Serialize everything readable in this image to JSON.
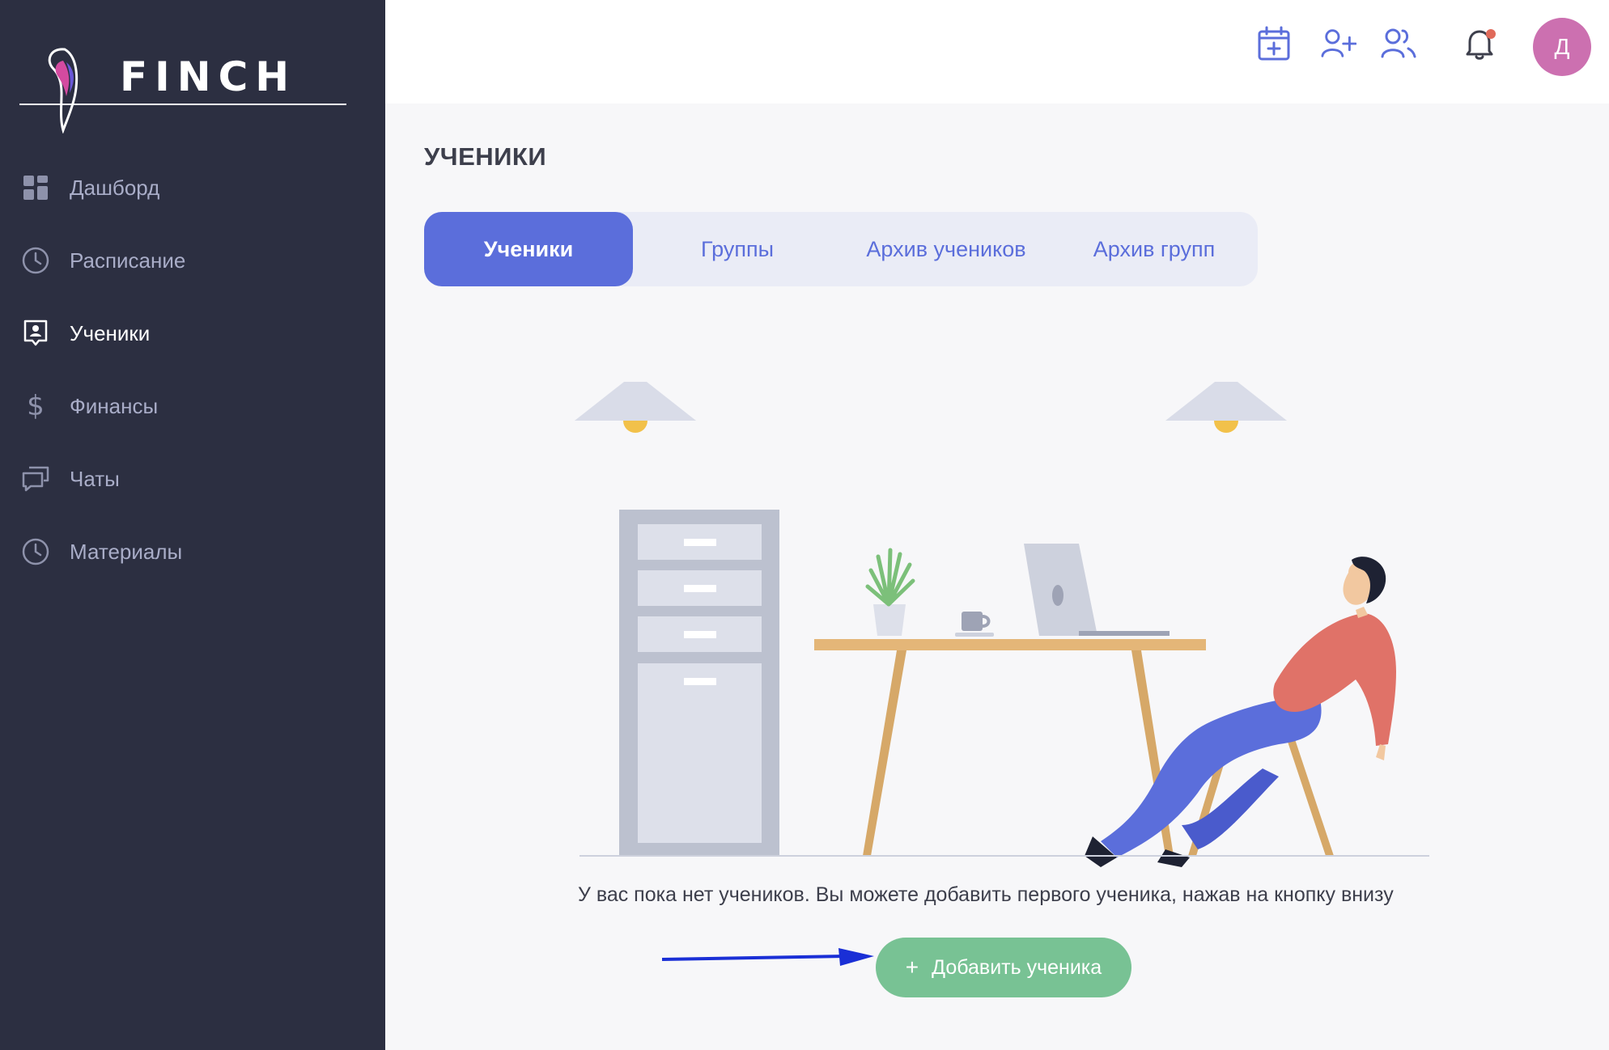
{
  "brand": {
    "name": "FINCH"
  },
  "sidebar": {
    "items": [
      {
        "label": "Дашборд",
        "icon": "dashboard-icon"
      },
      {
        "label": "Расписание",
        "icon": "clock-icon"
      },
      {
        "label": "Ученики",
        "icon": "student-card-icon",
        "active": true
      },
      {
        "label": "Финансы",
        "icon": "dollar-icon"
      },
      {
        "label": "Чаты",
        "icon": "chat-icon"
      },
      {
        "label": "Материалы",
        "icon": "clock-icon"
      }
    ]
  },
  "header": {
    "icons": [
      "calendar-add-icon",
      "add-user-icon",
      "users-icon",
      "bell-icon"
    ],
    "avatar_initial": "Д"
  },
  "main": {
    "title": "УЧЕНИКИ",
    "tabs": [
      {
        "label": "Ученики",
        "active": true
      },
      {
        "label": "Группы"
      },
      {
        "label": "Архив учеников"
      },
      {
        "label": "Архив групп"
      }
    ],
    "empty_message": "У вас пока нет учеников. Вы можете добавить первого ученика, нажав на кнопку внизу",
    "add_button_label": "Добавить ученика"
  },
  "colors": {
    "sidebar_bg": "#2c2f41",
    "accent": "#5b6edb",
    "add_button": "#78c294",
    "avatar": "#cc70b0",
    "arrow": "#1a2fd6"
  }
}
